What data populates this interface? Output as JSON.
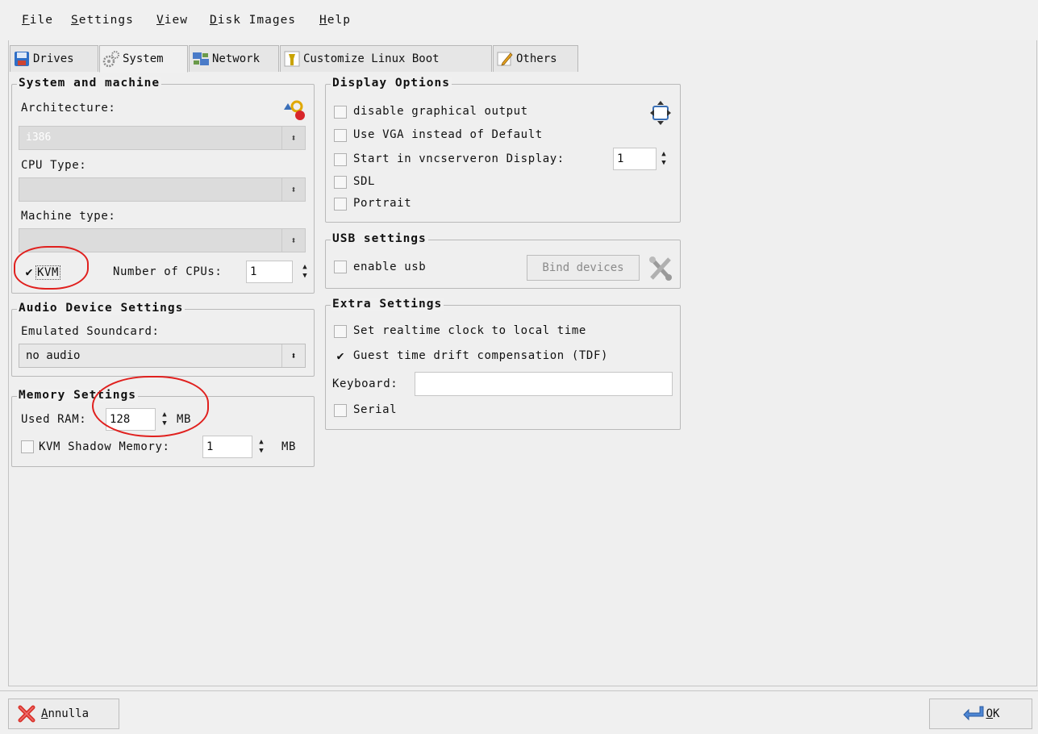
{
  "menu": {
    "file": {
      "u": "F",
      "rest": "ile"
    },
    "settings": {
      "u": "S",
      "rest": "ettings"
    },
    "view": {
      "u": "V",
      "rest": "iew"
    },
    "disk": {
      "u": "D",
      "rest": "isk Images"
    },
    "help": {
      "u": "H",
      "rest": "elp"
    }
  },
  "tabs": {
    "drives": "Drives",
    "system": "System",
    "network": "Network",
    "linux_boot": "Customize Linux Boot",
    "others": "Others"
  },
  "system_machine": {
    "title": "System and machine",
    "architecture_label": "Architecture:",
    "architecture_value": "i386",
    "cpu_type_label": "CPU Type:",
    "cpu_type_value": "",
    "machine_type_label": "Machine type:",
    "machine_type_value": "",
    "kvm_label": "KVM",
    "kvm_checked": true,
    "num_cpus_label": "Number of CPUs:",
    "num_cpus_value": "1"
  },
  "audio": {
    "title": "Audio Device Settings",
    "soundcard_label": "Emulated Soundcard:",
    "soundcard_value": "no audio"
  },
  "memory": {
    "title": "Memory Settings",
    "used_ram_label": "Used RAM:",
    "used_ram_value": "128",
    "used_ram_unit": "MB",
    "kvm_shadow_label": "KVM Shadow Memory:",
    "kvm_shadow_value": "1",
    "kvm_shadow_unit": "MB"
  },
  "display": {
    "title": "Display Options",
    "disable_graphical": "disable graphical output",
    "use_vga": "Use VGA instead of Default",
    "start_vnc": "Start in vncserveron Display:",
    "vnc_display_value": "1",
    "sdl": "SDL",
    "portrait": "Portrait"
  },
  "usb": {
    "title": "USB settings",
    "enable_usb": "enable usb",
    "bind_devices": "Bind devices"
  },
  "extra": {
    "title": "Extra Settings",
    "rtc_local": "Set realtime clock to local time",
    "tdf": "Guest time drift compensation (TDF)",
    "tdf_checked": true,
    "keyboard_label": "Keyboard:",
    "keyboard_value": "",
    "serial": "Serial"
  },
  "footer": {
    "cancel_u": "A",
    "cancel_rest": "nnulla",
    "ok_u": "O",
    "ok_rest": "K"
  },
  "colors": {
    "annotation": "#e0201e",
    "background": "#f0f0f0"
  }
}
